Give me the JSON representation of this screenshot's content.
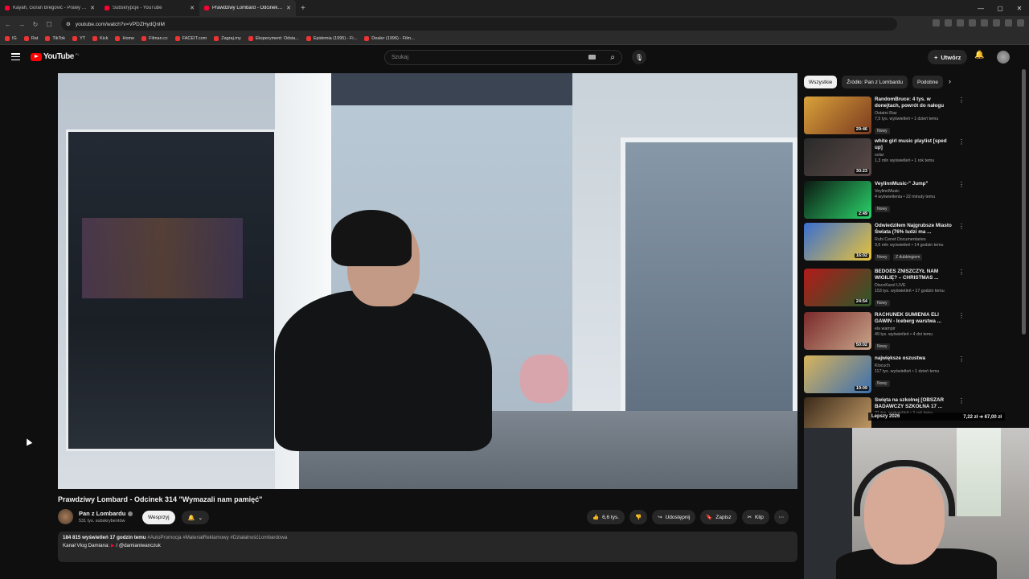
{
  "browser": {
    "tabs": [
      {
        "title": "Kayah, Goran Bregović - Prawy d...",
        "active": false
      },
      {
        "title": "Subskrypcje - YouTube",
        "active": false
      },
      {
        "title": "Prawdziwy Lombard - Odcinek 314",
        "active": true
      }
    ],
    "url": "youtube.com/watch?v=VPDZHydQnlM",
    "bookmarks": [
      "IG",
      "Rat",
      "TikTok",
      "YT",
      "Kick",
      "Home",
      "Filman.cc",
      "FACEIT.com",
      "Zagraj.my",
      "Eksperyment: Odsia...",
      "Epidemia (1995) - Fi...",
      "Dealer (1996) - Film..."
    ]
  },
  "header": {
    "logo_text": "YouTube",
    "logo_country": "PL",
    "search_placeholder": "Szukaj",
    "create_label": "Utwórz"
  },
  "video": {
    "title": "Prawdziwy Lombard - Odcinek 314 \"Wymazali nam pamięć\"",
    "channel_name": "Pan z Lombardu",
    "subscribers": "531 tys. subskrybentów",
    "support_label": "Wesprzyj",
    "likes": "6,6 tys.",
    "share_label": "Udostępnij",
    "save_label": "Zapisz",
    "clip_label": "Klip",
    "views_date": "184 815 wyświetleń  17 godzin temu",
    "hashtags": "#AutoPromocja #MateriałReklamowy #DziałalnośćLombardowa",
    "desc_line2_prefix": "Kanał Vlog Damiana:",
    "desc_line2_handle": "/ @damianiwanczuk"
  },
  "sidebar": {
    "chips": [
      "Wszystkie",
      "Źródło: Pan z Lombardu",
      "Podobne"
    ],
    "recommendations": [
      {
        "title": "RandomBruce: 4 tys. w donejtach, powrót do nałogu",
        "channel": "Ostatni Raz",
        "views": "7,5 tys. wyświetleń • 1 dzień temu",
        "badge": "Nowy",
        "duration": "29:46",
        "colors": [
          "#d9a23a",
          "#7b3a1f"
        ]
      },
      {
        "title": "white girl music playlist [sped up]",
        "channel": "solar",
        "views": "1,3 mln wyświetleń • 1 rok temu",
        "badge": "",
        "duration": "30:23",
        "colors": [
          "#2a2a2a",
          "#5b4a48"
        ]
      },
      {
        "title": "VeylinnMusic-\" Jump\"",
        "channel": "VeylinnMusic",
        "views": "4 wyświetlenia • 22 minuty temu",
        "badge": "Nowy",
        "duration": "2:49",
        "colors": [
          "#0c1a12",
          "#2bd36b"
        ]
      },
      {
        "title": "Odwiedziłem Najgrubsze Miasto Świata (76% ludzi ma ...",
        "channel": "Ruhi Cenet Documentaries",
        "views": "3,6 mln wyświetleń • 14 godzin temu",
        "badge": "Nowy",
        "badge2": "Z dubbingiem",
        "duration": "16:02",
        "colors": [
          "#3a6fd1",
          "#e8c23a"
        ]
      },
      {
        "title": "BEDOES ZNISZCZYŁ NAM WIGILIĘ? – CHRISTMAS ...",
        "channel": "DiscoKarol LIVE",
        "views": "153 tys. wyświetleń • 17 godzin temu",
        "badge": "Nowy",
        "duration": "24:54",
        "colors": [
          "#b31a1a",
          "#2a5a2a"
        ]
      },
      {
        "title": "RACHUNEK SUMIENIA ELI GAWIN - Iceberg warstwa ...",
        "channel": "ela wampir",
        "views": "49 tys. wyświetleń • 4 dni temu",
        "badge": "Nowy",
        "duration": "50:02",
        "colors": [
          "#7a2a2a",
          "#c9a58a"
        ]
      },
      {
        "title": "największe oszustwa",
        "channel": "Klocuch",
        "views": "117 tys. wyświetleń • 1 dzień temu",
        "badge": "Nowy",
        "duration": "19:09",
        "colors": [
          "#d9b45a",
          "#3a6fb1"
        ]
      },
      {
        "title": "Święta na szkolnej [OBSZAR BADAWCZY SZKOŁNA 17 ...",
        "channel": "",
        "views": "21 tys. wyświetleń • 1 rok temu",
        "badge": "",
        "duration": "",
        "colors": [
          "#3a2a1a",
          "#c9a06a"
        ]
      }
    ]
  },
  "overlay": {
    "left_text": "Lepszy 2026",
    "right_text": "7,22 zł ➜ 67,00 zł"
  }
}
